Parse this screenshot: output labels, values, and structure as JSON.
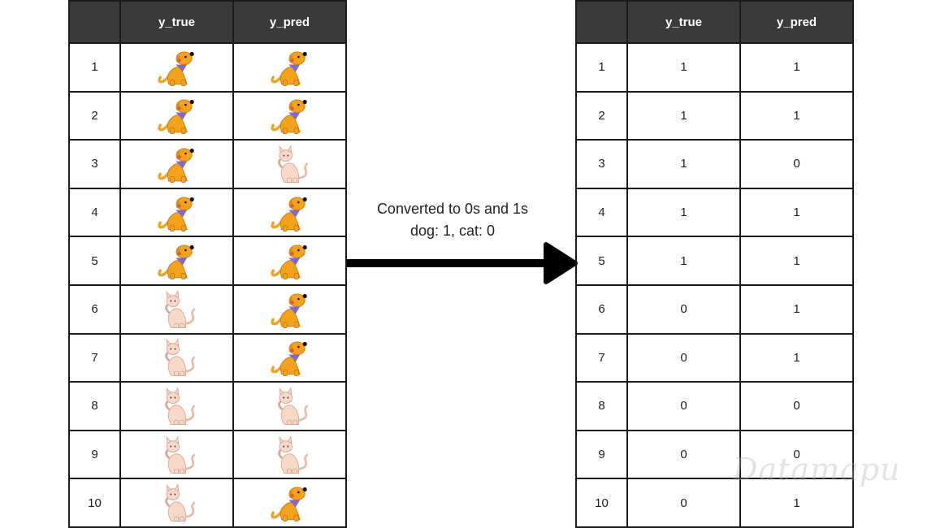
{
  "left_table": {
    "headers": [
      "",
      "y_true",
      "y_pred"
    ],
    "rows": [
      {
        "index": "1",
        "y_true": "dog",
        "y_pred": "dog"
      },
      {
        "index": "2",
        "y_true": "dog",
        "y_pred": "dog"
      },
      {
        "index": "3",
        "y_true": "dog",
        "y_pred": "cat"
      },
      {
        "index": "4",
        "y_true": "dog",
        "y_pred": "dog"
      },
      {
        "index": "5",
        "y_true": "dog",
        "y_pred": "dog"
      },
      {
        "index": "6",
        "y_true": "cat",
        "y_pred": "dog"
      },
      {
        "index": "7",
        "y_true": "cat",
        "y_pred": "dog"
      },
      {
        "index": "8",
        "y_true": "cat",
        "y_pred": "cat"
      },
      {
        "index": "9",
        "y_true": "cat",
        "y_pred": "cat"
      },
      {
        "index": "10",
        "y_true": "cat",
        "y_pred": "dog"
      }
    ]
  },
  "caption": {
    "line1": "Converted to 0s and 1s",
    "line2": "dog: 1, cat: 0"
  },
  "right_table": {
    "headers": [
      "",
      "y_true",
      "y_pred"
    ],
    "rows": [
      {
        "index": "1",
        "y_true": "1",
        "y_pred": "1"
      },
      {
        "index": "2",
        "y_true": "1",
        "y_pred": "1"
      },
      {
        "index": "3",
        "y_true": "1",
        "y_pred": "0"
      },
      {
        "index": "4",
        "y_true": "1",
        "y_pred": "1"
      },
      {
        "index": "5",
        "y_true": "1",
        "y_pred": "1"
      },
      {
        "index": "6",
        "y_true": "0",
        "y_pred": "1"
      },
      {
        "index": "7",
        "y_true": "0",
        "y_pred": "1"
      },
      {
        "index": "8",
        "y_true": "0",
        "y_pred": "0"
      },
      {
        "index": "9",
        "y_true": "0",
        "y_pred": "0"
      },
      {
        "index": "10",
        "y_true": "0",
        "y_pred": "1"
      }
    ]
  },
  "watermark": "Datamapu",
  "colors": {
    "header_bg": "#3a3a3a",
    "dog": "#f2a31b",
    "dog_collar": "#7d68d6",
    "cat": "#f8d8c8",
    "arrow": "#000000"
  },
  "icons": {
    "dog": "dog-icon",
    "cat": "cat-icon"
  }
}
